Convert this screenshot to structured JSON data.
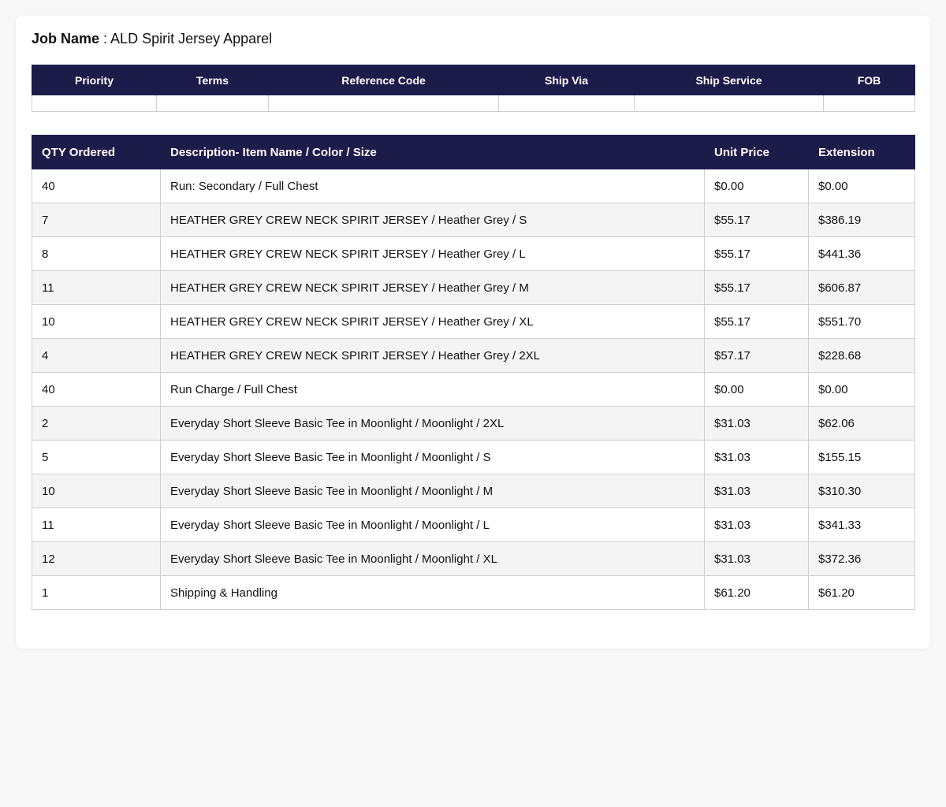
{
  "job": {
    "label": "Job Name",
    "separator": " : ",
    "value": "ALD Spirit Jersey Apparel"
  },
  "info_table": {
    "headers": [
      "Priority",
      "Terms",
      "Reference Code",
      "Ship Via",
      "Ship Service",
      "FOB"
    ],
    "values": [
      "",
      "",
      "",
      "",
      "",
      ""
    ]
  },
  "items_table": {
    "headers": [
      "QTY Ordered",
      "Description- Item Name / Color / Size",
      "Unit Price",
      "Extension"
    ],
    "rows": [
      {
        "qty": "40",
        "description": "Run: Secondary / Full Chest",
        "unit_price": "$0.00",
        "extension": "$0.00"
      },
      {
        "qty": "7",
        "description": "HEATHER GREY CREW NECK SPIRIT JERSEY / Heather Grey / S",
        "unit_price": "$55.17",
        "extension": "$386.19"
      },
      {
        "qty": "8",
        "description": "HEATHER GREY CREW NECK SPIRIT JERSEY / Heather Grey / L",
        "unit_price": "$55.17",
        "extension": "$441.36"
      },
      {
        "qty": "11",
        "description": "HEATHER GREY CREW NECK SPIRIT JERSEY / Heather Grey / M",
        "unit_price": "$55.17",
        "extension": "$606.87"
      },
      {
        "qty": "10",
        "description": "HEATHER GREY CREW NECK SPIRIT JERSEY / Heather Grey / XL",
        "unit_price": "$55.17",
        "extension": "$551.70"
      },
      {
        "qty": "4",
        "description": "HEATHER GREY CREW NECK SPIRIT JERSEY / Heather Grey / 2XL",
        "unit_price": "$57.17",
        "extension": "$228.68"
      },
      {
        "qty": "40",
        "description": "Run Charge / Full Chest",
        "unit_price": "$0.00",
        "extension": "$0.00"
      },
      {
        "qty": "2",
        "description": "Everyday Short Sleeve Basic Tee in Moonlight / Moonlight / 2XL",
        "unit_price": "$31.03",
        "extension": "$62.06"
      },
      {
        "qty": "5",
        "description": "Everyday Short Sleeve Basic Tee in Moonlight / Moonlight / S",
        "unit_price": "$31.03",
        "extension": "$155.15"
      },
      {
        "qty": "10",
        "description": "Everyday Short Sleeve Basic Tee in Moonlight / Moonlight / M",
        "unit_price": "$31.03",
        "extension": "$310.30"
      },
      {
        "qty": "11",
        "description": "Everyday Short Sleeve Basic Tee in Moonlight / Moonlight / L",
        "unit_price": "$31.03",
        "extension": "$341.33"
      },
      {
        "qty": "12",
        "description": "Everyday Short Sleeve Basic Tee in Moonlight / Moonlight / XL",
        "unit_price": "$31.03",
        "extension": "$372.36"
      },
      {
        "qty": "1",
        "description": "Shipping & Handling",
        "unit_price": "$61.20",
        "extension": "$61.20"
      }
    ]
  },
  "colors": {
    "header_bg": "#1c1c4b",
    "header_text": "#ffffff",
    "stripe_bg": "#f4f4f4",
    "page_bg": "#f8f8f8"
  }
}
